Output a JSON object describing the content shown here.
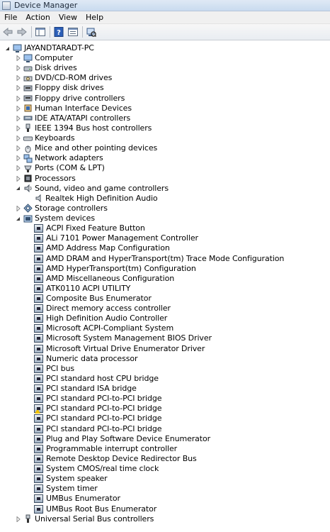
{
  "window": {
    "title": "Device Manager"
  },
  "menu": [
    "File",
    "Action",
    "View",
    "Help"
  ],
  "toolbar": [
    {
      "name": "back-icon"
    },
    {
      "name": "forward-icon"
    },
    {
      "name": "show-hide-console-tree-icon"
    },
    {
      "name": "help-icon"
    },
    {
      "name": "properties-icon"
    },
    {
      "name": "scan-hardware-icon"
    }
  ],
  "tree": {
    "root": "JAYANDTARADT-PC",
    "categories": [
      "Computer",
      "Disk drives",
      "DVD/CD-ROM drives",
      "Floppy disk drives",
      "Floppy drive controllers",
      "Human Interface Devices",
      "IDE ATA/ATAPI controllers",
      "IEEE 1394 Bus host controllers",
      "Keyboards",
      "Mice and other pointing devices",
      "Network adapters",
      "Ports (COM & LPT)",
      "Processors",
      "Sound, video and game controllers",
      "Storage controllers",
      "System devices",
      "Universal Serial Bus controllers"
    ],
    "sound_devices": [
      "Realtek High Definition Audio"
    ],
    "system_devices": [
      "ACPI Fixed Feature Button",
      "ALi 7101 Power Management Controller",
      "AMD Address Map Configuration",
      "AMD DRAM and HyperTransport(tm) Trace Mode Configuration",
      "AMD HyperTransport(tm) Configuration",
      "AMD Miscellaneous Configuration",
      "ATK0110 ACPI UTILITY",
      "Composite Bus Enumerator",
      "Direct memory access controller",
      "High Definition Audio Controller",
      "Microsoft ACPI-Compliant System",
      "Microsoft System Management BIOS Driver",
      "Microsoft Virtual Drive Enumerator Driver",
      "Numeric data processor",
      "PCI bus",
      "PCI standard host CPU bridge",
      "PCI standard ISA bridge",
      "PCI standard PCI-to-PCI bridge",
      "PCI standard PCI-to-PCI bridge",
      "PCI standard PCI-to-PCI bridge",
      "PCI standard PCI-to-PCI bridge",
      "Plug and Play Software Device Enumerator",
      "Programmable interrupt controller",
      "Remote Desktop Device Redirector Bus",
      "System CMOS/real time clock",
      "System speaker",
      "System timer",
      "UMBus Enumerator",
      "UMBus Root Bus Enumerator"
    ],
    "warning_device_index": 18
  }
}
